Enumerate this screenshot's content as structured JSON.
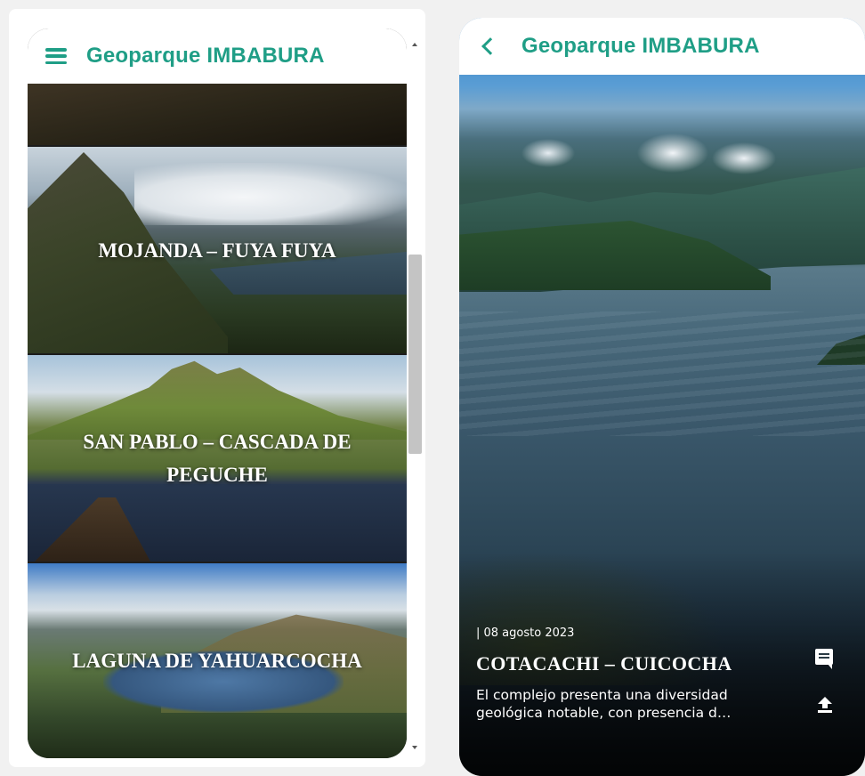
{
  "left_screen": {
    "header": {
      "title": "Geoparque IMBABURA",
      "menu_icon": "hamburger-menu-icon"
    },
    "cards": [
      {
        "title": ""
      },
      {
        "title": "MOJANDA – FUYA FUYA"
      },
      {
        "title": "SAN PABLO – CASCADA DE PEGUCHE"
      },
      {
        "title": "LAGUNA DE YAHUARCOCHA"
      }
    ]
  },
  "right_screen": {
    "header": {
      "title": "Geoparque IMBABURA",
      "back_icon": "chevron-left-icon"
    },
    "date": "| 08 agosto 2023",
    "title": "COTACACHI – CUICOCHA",
    "description": "El complejo presenta una diversidad geológica notable, con presencia d…",
    "icons": [
      "comment-icon",
      "share-icon"
    ]
  },
  "colors": {
    "brand_teal": "#1f9e86",
    "header_background": "#ffffff",
    "page_background": "#f1f1f1"
  }
}
